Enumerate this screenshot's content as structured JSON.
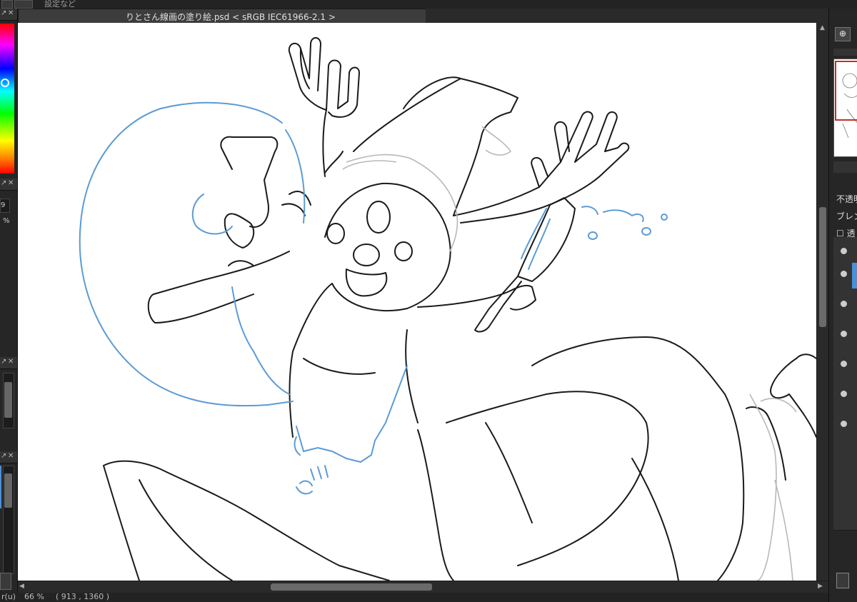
{
  "toolbar": {
    "title_text": "設定など"
  },
  "left_panel": {
    "value_text": "9",
    "percent_text": "%"
  },
  "document": {
    "tab_title": "りとさん線画の塗り絵.psd < sRGB IEC61966-2.1 >"
  },
  "status_bar": {
    "tool_text": "r(u)",
    "zoom": "66 %",
    "coordinates": "( 913 , 1360 )"
  },
  "right_panel": {
    "zoom_icon": "magnifier-icon",
    "opacity_label": "不透明",
    "blend_label": "ブレンド",
    "protect_label": "☐ 透"
  },
  "colors": {
    "accent": "#4a90d9",
    "canvas_bg": "#ffffff",
    "panel_bg": "#262626",
    "selection_frame": "#c0302a"
  }
}
